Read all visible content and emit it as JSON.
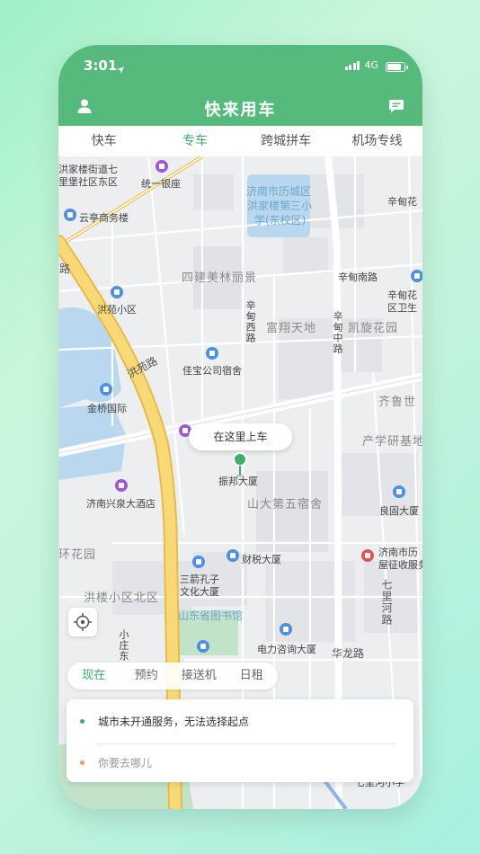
{
  "status": {
    "time": "3:01",
    "network": "4G"
  },
  "header": {
    "title": "快来用车"
  },
  "tabs": [
    {
      "label": "快车",
      "active": false
    },
    {
      "label": "专车",
      "active": true
    },
    {
      "label": "跨城拼车",
      "active": false
    },
    {
      "label": "机场专线",
      "active": false
    }
  ],
  "map": {
    "pickup_label": "在这里上车",
    "labels": {
      "a1": "洪家楼街道七",
      "a2": "里堡社区东区",
      "a3": "统一银座",
      "a4": "济南市历城区",
      "a5": "洪家楼第三小",
      "a6": "学(东校区)",
      "a7": "辛甸花",
      "a8": "云亭商务楼",
      "a9": "四建美林丽景",
      "a10": "辛甸南路",
      "a11": "辛甸花",
      "a12": "区卫生",
      "a13": "洪苑小区",
      "a14": "辛甸西路",
      "a15": "富翔天地",
      "a16": "辛甸中路",
      "a17": "凯旋花园",
      "a18": "洪苑路",
      "a19": "佳宝公司宿舍",
      "a20": "齐鲁世",
      "a21": "金桥国际",
      "a22": "产学研基地",
      "a23": "振邦大厦",
      "a24": "济南兴泉大酒店",
      "a25": "山大第五宿舍",
      "a26": "良固大厦",
      "a27": "环花园",
      "a28": "财税大厦",
      "a29": "济南市历",
      "a30": "屋征收服务",
      "a31": "三箭孔子",
      "a32": "文化大厦",
      "a33": "洪楼小区北区",
      "a34": "七里河路",
      "a35": "山东省图书馆",
      "a36": "小庄东",
      "a37": "电力咨询大厦",
      "a38": "华龙路",
      "a39": "路",
      "a40": "七里河小学"
    }
  },
  "mode_tabs": [
    {
      "label": "现在",
      "active": true
    },
    {
      "label": "预约",
      "active": false
    },
    {
      "label": "接送机",
      "active": false
    },
    {
      "label": "日租",
      "active": false
    }
  ],
  "panel": {
    "origin_text": "城市未开通服务，无法选择起点",
    "destination_placeholder": "你要去哪儿"
  },
  "colors": {
    "brand": "#55ba7c",
    "active_tab": "#3fae6a",
    "origin_dot": "#3fae6a",
    "dest_dot": "#f0a05a"
  },
  "icons": [
    "location-arrow-icon",
    "user-icon",
    "message-icon",
    "locate-icon",
    "pickup-pin-icon"
  ]
}
